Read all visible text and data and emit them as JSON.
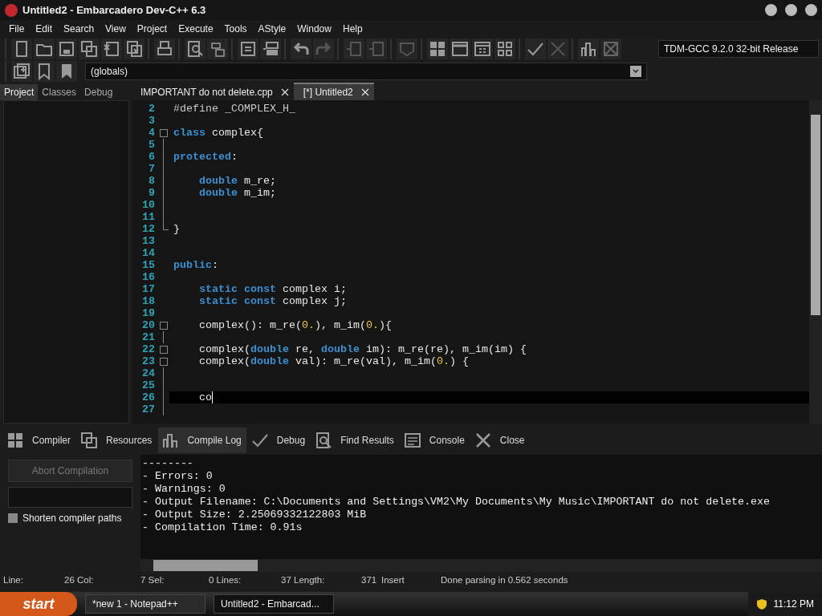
{
  "window": {
    "title": "Untitled2 - Embarcadero Dev-C++ 6.3"
  },
  "menu": [
    "File",
    "Edit",
    "Search",
    "View",
    "Project",
    "Execute",
    "Tools",
    "AStyle",
    "Window",
    "Help"
  ],
  "compiler_select": {
    "value": "TDM-GCC 9.2.0 32-bit Release"
  },
  "scope_select": {
    "value": "(globals)"
  },
  "side_tabs": [
    {
      "label": "Project",
      "selected": true
    },
    {
      "label": "Classes",
      "selected": false
    },
    {
      "label": "Debug",
      "selected": false
    }
  ],
  "editor_tabs": [
    {
      "label": "IMPORTANT do not delete.cpp",
      "selected": false
    },
    {
      "label": "[*] Untitled2",
      "selected": true
    }
  ],
  "editor": {
    "lines": [
      {
        "number": "2",
        "kind": "plain",
        "current": false,
        "tokens": [
          {
            "kind": "preproc",
            "text": "#define _COMPLEX_H_"
          }
        ]
      },
      {
        "number": "3",
        "kind": "plain",
        "current": false
      },
      {
        "number": "4",
        "kind": "start",
        "current": false,
        "tokens": [
          {
            "kind": "keyword",
            "text": "class"
          },
          {
            "kind": "plain",
            "text": " complex{"
          }
        ]
      },
      {
        "number": "5",
        "kind": "body",
        "current": false
      },
      {
        "number": "6",
        "kind": "body",
        "current": false,
        "tokens": [
          {
            "kind": "keyword",
            "text": "protected"
          },
          {
            "kind": "plain",
            "text": ":"
          }
        ]
      },
      {
        "number": "7",
        "kind": "body",
        "current": false
      },
      {
        "number": "8",
        "kind": "body",
        "current": false,
        "tokens": [
          {
            "kind": "keyword",
            "text": "    double"
          },
          {
            "kind": "plain",
            "text": " m_re;"
          }
        ]
      },
      {
        "number": "9",
        "kind": "body",
        "current": false,
        "tokens": [
          {
            "kind": "keyword",
            "text": "    double"
          },
          {
            "kind": "plain",
            "text": " m_im;"
          }
        ]
      },
      {
        "number": "10",
        "kind": "body",
        "current": false
      },
      {
        "number": "11",
        "kind": "body",
        "current": false
      },
      {
        "number": "12",
        "kind": "end",
        "current": false,
        "tokens": [
          {
            "kind": "plain",
            "text": "}"
          }
        ]
      },
      {
        "number": "13",
        "kind": "plain",
        "current": false
      },
      {
        "number": "14",
        "kind": "plain",
        "current": false
      },
      {
        "number": "15",
        "kind": "plain",
        "current": false,
        "tokens": [
          {
            "kind": "keyword",
            "text": "public"
          },
          {
            "kind": "plain",
            "text": ":"
          }
        ]
      },
      {
        "number": "16",
        "kind": "plain",
        "current": false
      },
      {
        "number": "17",
        "kind": "plain",
        "current": false,
        "tokens": [
          {
            "kind": "keyword",
            "text": "    static const"
          },
          {
            "kind": "plain",
            "text": " complex i;"
          }
        ]
      },
      {
        "number": "18",
        "kind": "plain",
        "current": false,
        "tokens": [
          {
            "kind": "keyword",
            "text": "    static const"
          },
          {
            "kind": "plain",
            "text": " complex j;"
          }
        ]
      },
      {
        "number": "19",
        "kind": "plain",
        "current": false
      },
      {
        "number": "20",
        "kind": "start",
        "current": false,
        "tokens": [
          {
            "kind": "plain",
            "text": "    complex(): m_re("
          },
          {
            "kind": "number",
            "text": "0."
          },
          {
            "kind": "plain",
            "text": "), m_im("
          },
          {
            "kind": "number",
            "text": "0."
          },
          {
            "kind": "plain",
            "text": "){"
          }
        ]
      },
      {
        "number": "21",
        "kind": "body",
        "current": false
      },
      {
        "number": "22",
        "kind": "start",
        "current": false,
        "tokens": [
          {
            "kind": "plain",
            "text": "    complex("
          },
          {
            "kind": "keyword",
            "text": "double"
          },
          {
            "kind": "plain",
            "text": " re, "
          },
          {
            "kind": "keyword",
            "text": "double"
          },
          {
            "kind": "plain",
            "text": " im): m_re(re), m_im(im) {"
          }
        ]
      },
      {
        "number": "23",
        "kind": "start",
        "current": false,
        "tokens": [
          {
            "kind": "plain",
            "text": "    complex("
          },
          {
            "kind": "keyword",
            "text": "double"
          },
          {
            "kind": "plain",
            "text": " val): m_re(val), m_im("
          },
          {
            "kind": "number",
            "text": "0."
          },
          {
            "kind": "plain",
            "text": ") {"
          }
        ]
      },
      {
        "number": "24",
        "kind": "body",
        "current": false
      },
      {
        "number": "25",
        "kind": "body",
        "current": false
      },
      {
        "number": "26",
        "kind": "body",
        "current": true,
        "tokens": [
          {
            "kind": "plain",
            "text": "    co"
          }
        ]
      },
      {
        "number": "27",
        "kind": "body",
        "current": false
      }
    ]
  },
  "bottom_tabs": [
    {
      "label": "Compiler",
      "selected": false
    },
    {
      "label": "Resources",
      "selected": false
    },
    {
      "label": "Compile Log",
      "selected": true
    },
    {
      "label": "Debug",
      "selected": false
    },
    {
      "label": "Find Results",
      "selected": false
    },
    {
      "label": "Console",
      "selected": false
    },
    {
      "label": "Close",
      "selected": false
    }
  ],
  "abort_button": {
    "label": "Abort Compilation",
    "disabled": true
  },
  "shorten_paths": {
    "label": "Shorten compiler paths",
    "checked": false
  },
  "compile_log": [
    "--------",
    "- Errors: 0",
    "- Warnings: 0",
    "- Output Filename: C:\\Documents and Settings\\VM2\\My Documents\\My Music\\IMPORTANT do not delete.exe",
    "- Output Size: 2.25069332122803 MiB",
    "- Compilation Time: 0.91s"
  ],
  "status_bar": [
    "Line:",
    "26 Col:",
    "7 Sel:",
    "0 Lines:",
    "37 Length:",
    "371",
    "Insert",
    "Done parsing in 0.562 seconds"
  ],
  "taskbar": {
    "start": "start",
    "tasks": [
      {
        "label": "*new 1 - Notepad++",
        "selected": false
      },
      {
        "label": "Untitled2 - Embarcad...",
        "selected": true
      }
    ],
    "clock": "11:12 PM"
  }
}
